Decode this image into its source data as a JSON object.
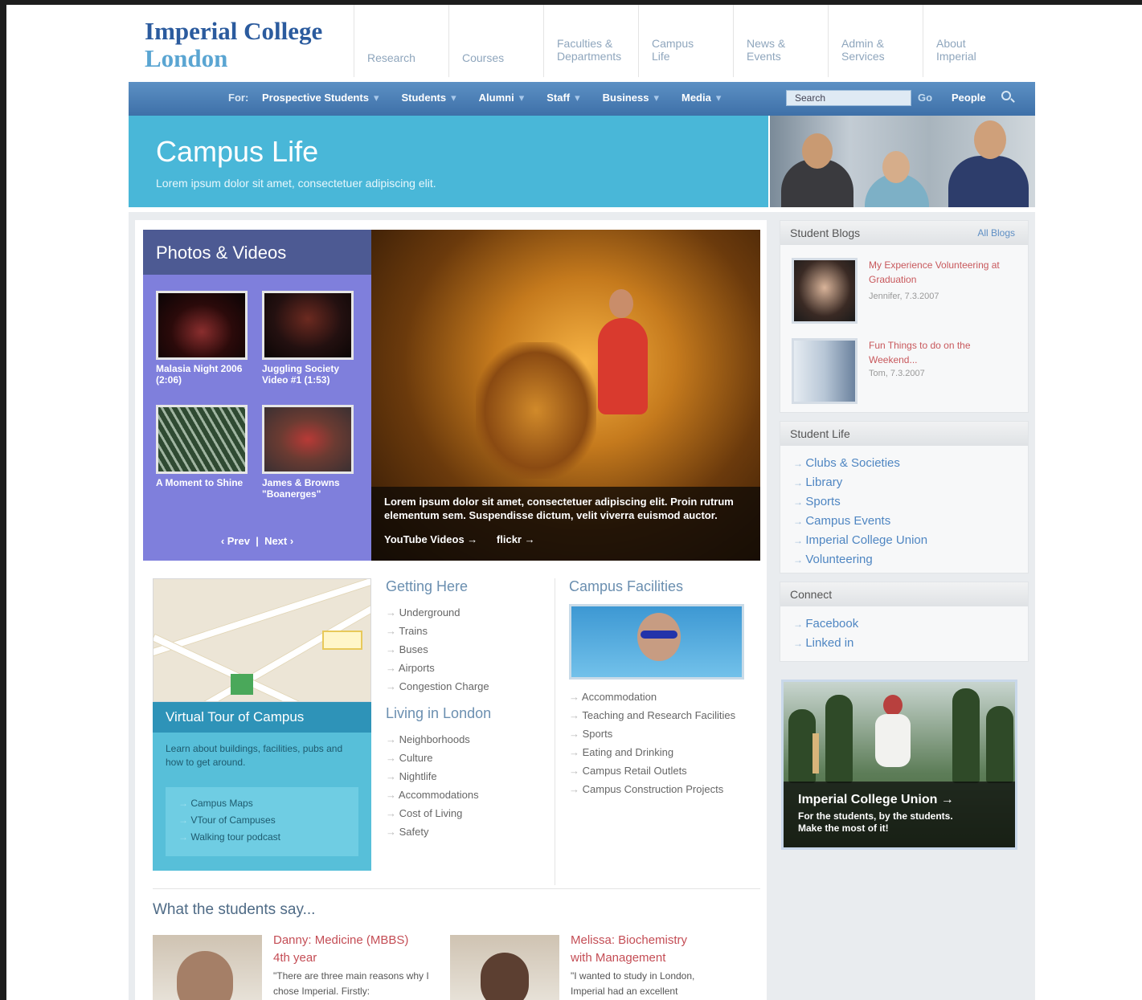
{
  "logo": {
    "line1": "Imperial College",
    "line2": "London"
  },
  "topnav": [
    {
      "l1": "Research",
      "l2": ""
    },
    {
      "l1": "Courses",
      "l2": ""
    },
    {
      "l1": "Faculties &",
      "l2": "Departments"
    },
    {
      "l1": "Campus",
      "l2": "Life"
    },
    {
      "l1": "News &",
      "l2": "Events"
    },
    {
      "l1": "Admin &",
      "l2": "Services"
    },
    {
      "l1": "About",
      "l2": "Imperial"
    }
  ],
  "navbar": {
    "for_label": "For:",
    "items": [
      "Prospective Students",
      "Students",
      "Alumni",
      "Staff",
      "Business",
      "Media"
    ],
    "search_placeholder": "Search",
    "go": "Go",
    "people": "People"
  },
  "hero": {
    "title": "Campus Life",
    "subtitle": "Lorem ipsum dolor sit amet, consectetuer adipiscing elit."
  },
  "photos": {
    "title": "Photos & Videos",
    "thumbs": [
      {
        "caption": "Malasia Night 2006 (2:06)"
      },
      {
        "caption": "Juggling Society Video #1 (1:53)"
      },
      {
        "caption": "A Moment to Shine"
      },
      {
        "caption": "James & Browns \"Boanerges\""
      }
    ],
    "prev": "‹ Prev",
    "sep": "|",
    "next": "Next ›"
  },
  "main_photo": {
    "caption": "Lorem ipsum dolor sit amet, consectetuer adipiscing elit. Proin rutrum elementum sem. Suspendisse dictum, velit viverra euismod auctor.",
    "link1": "YouTube Videos →",
    "link2": "flickr →"
  },
  "virtual_tour": {
    "title": "Virtual Tour of Campus",
    "desc": "Learn about buildings, facilities, pubs and how to get around.",
    "links": [
      "Campus Maps",
      "VTour of Campuses",
      "Walking tour podcast"
    ]
  },
  "getting_here": {
    "title": "Getting Here",
    "items": [
      "Underground",
      "Trains",
      "Buses",
      "Airports",
      "Congestion Charge"
    ]
  },
  "living": {
    "title": "Living in London",
    "items": [
      "Neighborhoods",
      "Culture",
      "Nightlife",
      "Accommodations",
      "Cost of Living",
      "Safety"
    ]
  },
  "facilities": {
    "title": "Campus Facilities",
    "items": [
      "Accommodation",
      "Teaching and Research Facilities",
      "Sports",
      "Eating and Drinking",
      "Campus Retail Outlets",
      "Campus Construction Projects"
    ]
  },
  "testimonials": {
    "heading": "What the students say...",
    "items": [
      {
        "name1": "Danny: Medicine (MBBS)",
        "name2": "4th year",
        "quote": "\"There are three main reasons why I chose Imperial. Firstly:"
      },
      {
        "name1": "Melissa: Biochemistry",
        "name2": "with Management",
        "quote": "\"I wanted to study in London, Imperial had an excellent"
      }
    ]
  },
  "sidebar": {
    "blogs": {
      "title": "Student Blogs",
      "all": "All Blogs",
      "items": [
        {
          "title": "My Experience Volunteering at Graduation",
          "meta": "Jennifer, 7.3.2007"
        },
        {
          "title": "Fun Things to do on the Weekend...",
          "meta": "Tom, 7.3.2007"
        }
      ]
    },
    "student_life": {
      "title": "Student Life",
      "items": [
        "Clubs & Societies",
        "Library",
        "Sports",
        "Campus Events",
        "Imperial College Union",
        "Volunteering"
      ]
    },
    "connect": {
      "title": "Connect",
      "items": [
        "Facebook",
        "Linked in"
      ]
    },
    "union": {
      "title": "Imperial College Union →",
      "line1": "For the students, by the students.",
      "line2": "Make the most of it!"
    }
  },
  "colors": {
    "navbar": "#4a7db5",
    "hero": "#49b7d8",
    "photos_panel": "#7f7fdc",
    "link_red": "#c8585c",
    "link_blue": "#4f86c2"
  }
}
